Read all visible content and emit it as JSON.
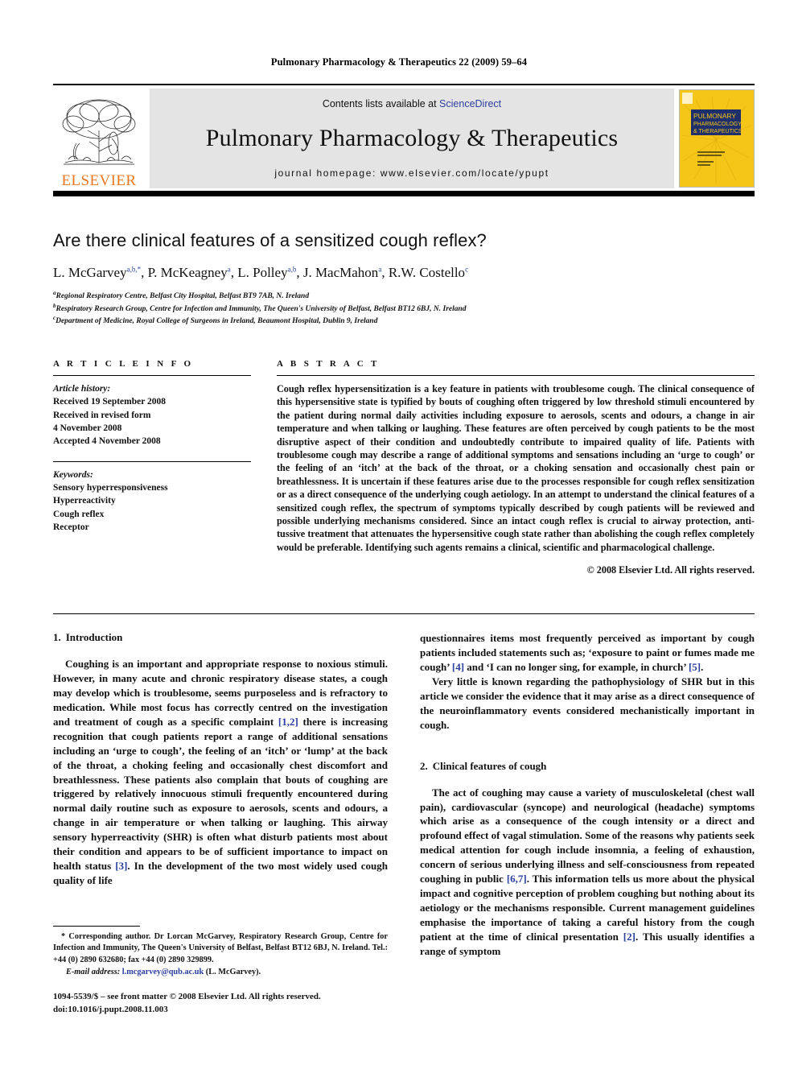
{
  "running_head": "Pulmonary Pharmacology & Therapeutics 22 (2009) 59–64",
  "masthead": {
    "contents_prefix": "Contents lists available at ",
    "sciencedirect": "ScienceDirect",
    "journal_title": "Pulmonary Pharmacology & Therapeutics",
    "homepage": "journal homepage: www.elsevier.com/locate/ypupt",
    "publisher_wordmark": "ELSEVIER",
    "publisher_color": "#E87722",
    "banner_color": "#e4e4e4",
    "link_color": "#2b3fa0",
    "cover": {
      "line1": "PULMONARY",
      "line2": "PHARMACOLOGY",
      "line3": "& THERAPEUTICS",
      "background_color": "#F5C518",
      "band_color": "#1e2f6b",
      "text_color": "#F5C518"
    }
  },
  "article": {
    "title": "Are there clinical features of a sensitized cough reflex?",
    "authors": [
      {
        "name": "L. McGarvey",
        "sup": "a,b,*"
      },
      {
        "name": "P. McKeagney",
        "sup": "a"
      },
      {
        "name": "L. Polley",
        "sup": "a,b"
      },
      {
        "name": "J. MacMahon",
        "sup": "a"
      },
      {
        "name": "R.W. Costello",
        "sup": "c"
      }
    ],
    "affiliations": [
      {
        "mark": "a",
        "text": "Regional Respiratory Centre, Belfast City Hospital, Belfast BT9 7AB, N. Ireland"
      },
      {
        "mark": "b",
        "text": "Respiratory Research Group, Centre for Infection and Immunity, The Queen's University of Belfast, Belfast BT12 6BJ, N. Ireland"
      },
      {
        "mark": "c",
        "text": "Department of Medicine, Royal College of Surgeons in Ireland, Beaumont Hospital, Dublin 9, Ireland"
      }
    ]
  },
  "article_info": {
    "heading": "A R T I C L E  I N F O",
    "history_label": "Article history:",
    "history": [
      "Received 19 September 2008",
      "Received in revised form",
      "4 November 2008",
      "Accepted 4 November 2008"
    ],
    "keywords_label": "Keywords:",
    "keywords": [
      "Sensory hyperresponsiveness",
      "Hyperreactivity",
      "Cough reflex",
      "Receptor"
    ]
  },
  "abstract": {
    "heading": "A B S T R A C T",
    "text": "Cough reflex hypersensitization is a key feature in patients with troublesome cough. The clinical consequence of this hypersensitive state is typified by bouts of coughing often triggered by low threshold stimuli encountered by the patient during normal daily activities including exposure to aerosols, scents and odours, a change in air temperature and when talking or laughing. These features are often perceived by cough patients to be the most disruptive aspect of their condition and undoubtedly contribute to impaired quality of life. Patients with troublesome cough may describe a range of additional symptoms and sensations including an ‘urge to cough’ or the feeling of an ‘itch’ at the back of the throat, or a choking sensation and occasionally chest pain or breathlessness. It is uncertain if these features arise due to the processes responsible for cough reflex sensitization or as a direct consequence of the underlying cough aetiology. In an attempt to understand the clinical features of a sensitized cough reflex, the spectrum of symptoms typically described by cough patients will be reviewed and possible underlying mechanisms considered. Since an intact cough reflex is crucial to airway protection, anti-tussive treatment that attenuates the hypersensitive cough state rather than abolishing the cough reflex completely would be preferable. Identifying such agents remains a clinical, scientific and pharmacological challenge.",
    "copyright": "© 2008 Elsevier Ltd. All rights reserved."
  },
  "body": {
    "left_column": {
      "section": {
        "number": "1.",
        "title": "Introduction"
      },
      "paragraph_parts": [
        {
          "t": "Coughing is an important and appropriate response to noxious stimuli. However, in many acute and chronic respiratory disease states, a cough may develop which is troublesome, seems purposeless and is refractory to medication. While most focus has correctly centred on the investigation and treatment of cough as a specific complaint "
        },
        {
          "t": "[1,2]",
          "ref": true
        },
        {
          "t": " there is increasing recognition that cough patients report a range of additional sensations including an ‘urge to cough’, the feeling of an ‘itch’ or ‘lump’ at the back of the throat, a choking feeling and occasionally chest discomfort and breathlessness. These patients also complain that bouts of coughing are triggered by relatively innocuous stimuli frequently encountered during normal daily routine such as exposure to aerosols, scents and odours, a change in air temperature or when talking or laughing. This airway sensory hyperreactivity (SHR) is often what disturb patients most about their condition and appears to be of sufficient importance to impact on health status "
        },
        {
          "t": "[3]",
          "ref": true
        },
        {
          "t": ". In the development of the two most widely used cough quality of life"
        }
      ]
    },
    "right_column": {
      "continuation_parts": [
        {
          "t": "questionnaires items most frequently perceived as important by cough patients included statements such as; ‘exposure to paint or fumes made me cough’ "
        },
        {
          "t": "[4]",
          "ref": true
        },
        {
          "t": " and ‘I can no longer sing, for example, in church’ "
        },
        {
          "t": "[5]",
          "ref": true
        },
        {
          "t": "."
        }
      ],
      "paragraph2": "Very little is known regarding the pathophysiology of SHR but in this article we consider the evidence that it may arise as a direct consequence of the neuroinflammatory events considered mechanistically important in cough.",
      "section": {
        "number": "2.",
        "title": "Clinical features of cough"
      },
      "paragraph3_parts": [
        {
          "t": "The act of coughing may cause a variety of musculoskeletal (chest wall pain), cardiovascular (syncope) and neurological (headache) symptoms which arise as a consequence of the cough intensity or a direct and profound effect of vagal stimulation. Some of the reasons why patients seek medical attention for cough include insomnia, a feeling of exhaustion, concern of serious underlying illness and self-consciousness from repeated coughing in public "
        },
        {
          "t": "[6,7]",
          "ref": true
        },
        {
          "t": ". This information tells us more about the physical impact and cognitive perception of problem coughing but nothing about its aetiology or the mechanisms responsible. Current management guidelines emphasise the importance of taking a careful history from the cough patient at the time of clinical presentation "
        },
        {
          "t": "[2]",
          "ref": true
        },
        {
          "t": ". This usually identifies a range of symptom"
        }
      ]
    }
  },
  "footnotes": {
    "corresponding": "* Corresponding author. Dr Lorcan McGarvey, Respiratory Research Group, Centre for Infection and Immunity, The Queen's University of Belfast, Belfast BT12 6BJ, N. Ireland. Tel.: +44 (0) 2890 632680; fax +44 (0) 2890 329899.",
    "email_label": "E-mail address:",
    "email": "l.mcgarvey@qub.ac.uk",
    "email_suffix": "(L. McGarvey).",
    "issn_line": "1094-5539/$ – see front matter © 2008 Elsevier Ltd. All rights reserved.",
    "doi_line": "doi:10.1016/j.pupt.2008.11.003"
  }
}
